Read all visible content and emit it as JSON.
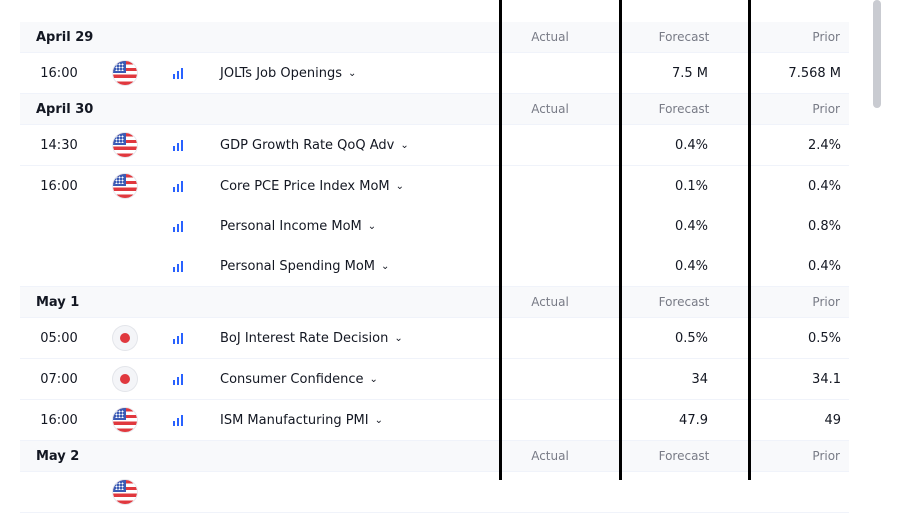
{
  "columns": {
    "actual": "Actual",
    "forecast": "Forecast",
    "prior": "Prior"
  },
  "days": [
    {
      "date": "April 29",
      "events": [
        {
          "time": "16:00",
          "country": "us-flag-icon",
          "name": "JOLTs Job Openings",
          "forecast": "7.5 M",
          "prior": "7.568 M"
        }
      ]
    },
    {
      "date": "April 30",
      "events": [
        {
          "time": "14:30",
          "country": "us-flag-icon",
          "name": "GDP Growth Rate QoQ Adv",
          "forecast": "0.4%",
          "prior": "2.4%"
        },
        {
          "time": "16:00",
          "country": "us-flag-icon",
          "name": "Core PCE Price Index MoM",
          "forecast": "0.1%",
          "prior": "0.4%"
        },
        {
          "time": "",
          "country": "",
          "name": "Personal Income MoM",
          "forecast": "0.4%",
          "prior": "0.8%"
        },
        {
          "time": "",
          "country": "",
          "name": "Personal Spending MoM",
          "forecast": "0.4%",
          "prior": "0.4%"
        }
      ]
    },
    {
      "date": "May 1",
      "events": [
        {
          "time": "05:00",
          "country": "jp-flag-icon",
          "name": "BoJ Interest Rate Decision",
          "forecast": "0.5%",
          "prior": "0.5%"
        },
        {
          "time": "07:00",
          "country": "jp-flag-icon",
          "name": "Consumer Confidence",
          "forecast": "34",
          "prior": "34.1"
        },
        {
          "time": "16:00",
          "country": "us-flag-icon",
          "name": "ISM Manufacturing PMI",
          "forecast": "47.9",
          "prior": "49"
        }
      ]
    },
    {
      "date": "May 2",
      "events": [
        {
          "time": "",
          "country": "us-flag-icon",
          "name": "",
          "forecast": "",
          "prior": ""
        }
      ]
    }
  ]
}
